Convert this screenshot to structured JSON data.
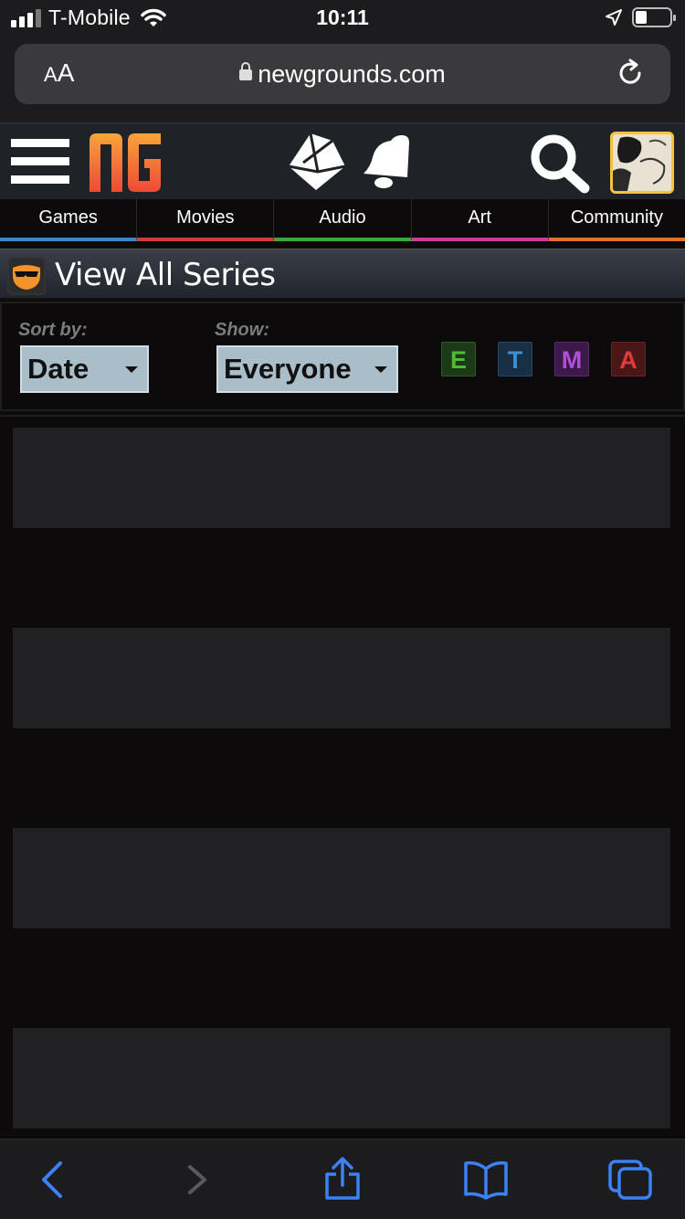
{
  "status_bar": {
    "carrier": "T-Mobile",
    "time": "10:11"
  },
  "address_bar": {
    "text_size_label_small": "A",
    "text_size_label_large": "A",
    "url": "newgrounds.com"
  },
  "nav": {
    "items": [
      {
        "label": "Games",
        "color": "#3f86c4"
      },
      {
        "label": "Movies",
        "color": "#d13a3a"
      },
      {
        "label": "Audio",
        "color": "#3fa63a"
      },
      {
        "label": "Art",
        "color": "#cf3a9b"
      },
      {
        "label": "Community",
        "color": "#e0702a"
      }
    ]
  },
  "page": {
    "title": "View All Series"
  },
  "filters": {
    "sort_label": "Sort by:",
    "sort_value": "Date",
    "show_label": "Show:",
    "show_value": "Everyone",
    "ratings": [
      {
        "letter": "E",
        "color": "#4fba33",
        "bg": "#1c3a17"
      },
      {
        "letter": "T",
        "color": "#3e8fd0",
        "bg": "#173046"
      },
      {
        "letter": "M",
        "color": "#b04fd6",
        "bg": "#3b1a4b"
      },
      {
        "letter": "A",
        "color": "#e03a3a",
        "bg": "#4a1717"
      }
    ]
  },
  "content": {
    "placeholder_count": 4
  },
  "colors": {
    "safari_chrome": "#1c1c1e",
    "toolbar_icon": "#3b82f6",
    "toolbar_icon_disabled": "#5a5a5e"
  }
}
